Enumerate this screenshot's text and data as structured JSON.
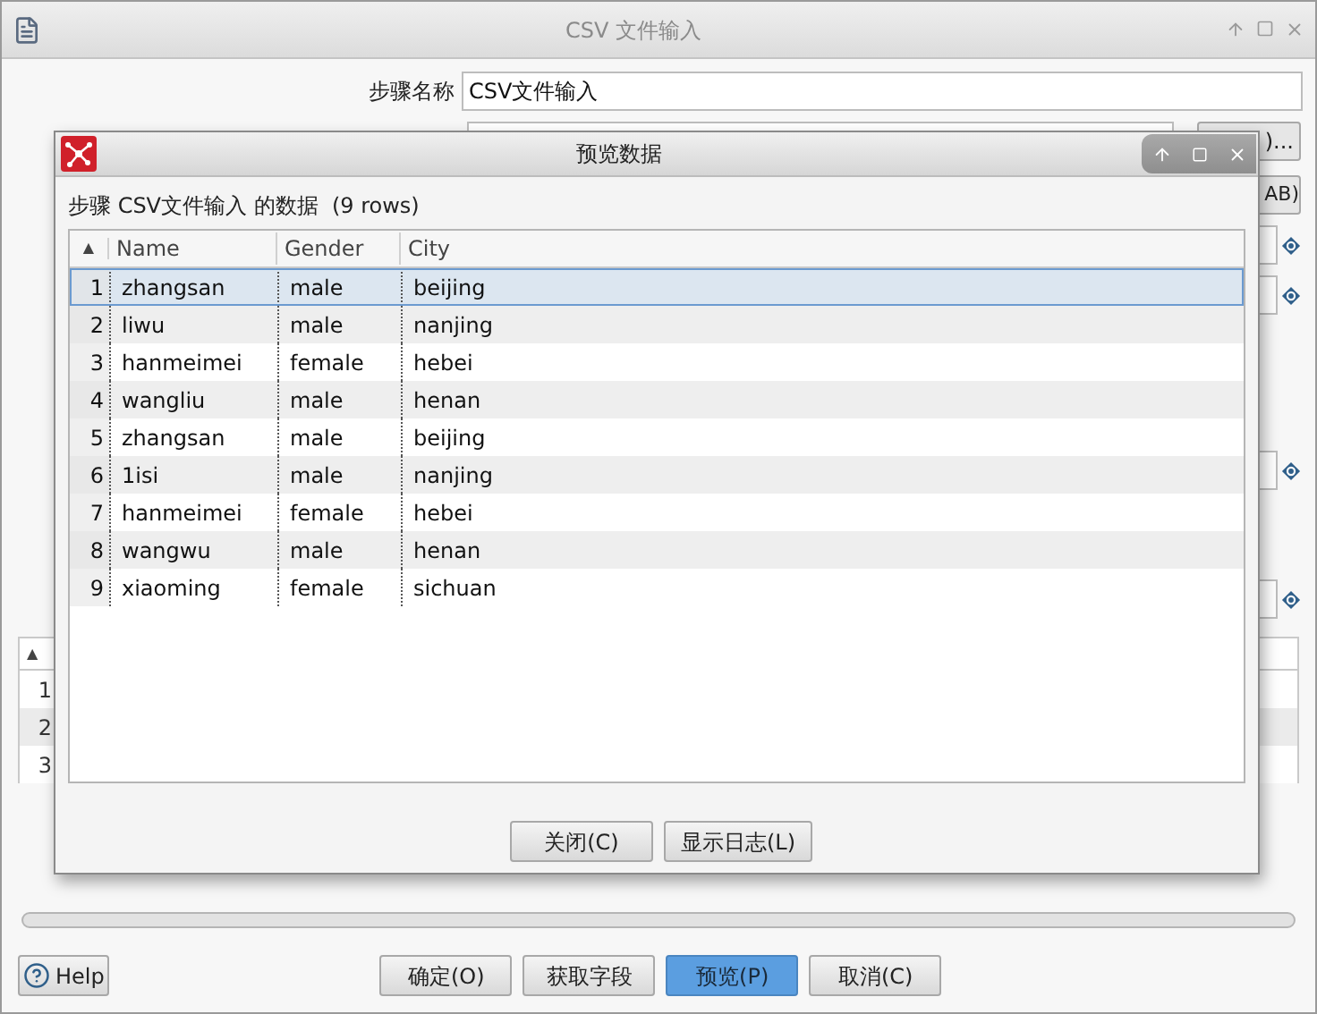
{
  "window": {
    "title": "CSV 文件输入"
  },
  "form": {
    "step_name_label": "步骤名称",
    "step_name_value": "CSV文件输入",
    "browse_button": ")...",
    "variable_button": "AB)"
  },
  "background_table": {
    "sort_indicator": "▲",
    "row_numbers": [
      "1",
      "2",
      "3"
    ]
  },
  "dialog": {
    "title": "预览数据",
    "caption": "步骤 CSV文件输入 的数据  (9 rows)",
    "sort_indicator": "▲",
    "columns": [
      "Name",
      "Gender",
      "City"
    ],
    "rows": [
      {
        "number": "1",
        "cells": [
          "zhangsan",
          "male",
          "beijing"
        ],
        "selected": true
      },
      {
        "number": "2",
        "cells": [
          "liwu",
          "male",
          "nanjing"
        ],
        "selected": false
      },
      {
        "number": "3",
        "cells": [
          "hanmeimei",
          "female",
          "hebei"
        ],
        "selected": false
      },
      {
        "number": "4",
        "cells": [
          "wangliu",
          "male",
          "henan"
        ],
        "selected": false
      },
      {
        "number": "5",
        "cells": [
          "zhangsan",
          "male",
          "beijing"
        ],
        "selected": false
      },
      {
        "number": "6",
        "cells": [
          "1isi",
          "male",
          "nanjing"
        ],
        "selected": false
      },
      {
        "number": "7",
        "cells": [
          "hanmeimei",
          "female",
          "hebei"
        ],
        "selected": false
      },
      {
        "number": "8",
        "cells": [
          "wangwu",
          "male",
          "henan"
        ],
        "selected": false
      },
      {
        "number": "9",
        "cells": [
          "xiaoming",
          "female",
          "sichuan"
        ],
        "selected": false
      }
    ],
    "buttons": [
      "关闭(C)",
      "显示日志(L)"
    ]
  },
  "help": "Help",
  "buttons": [
    {
      "label": "确定(O)",
      "primary": false
    },
    {
      "label": "获取字段",
      "primary": false
    },
    {
      "label": "预览(P)",
      "primary": true
    },
    {
      "label": "取消(C)",
      "primary": false
    }
  ]
}
